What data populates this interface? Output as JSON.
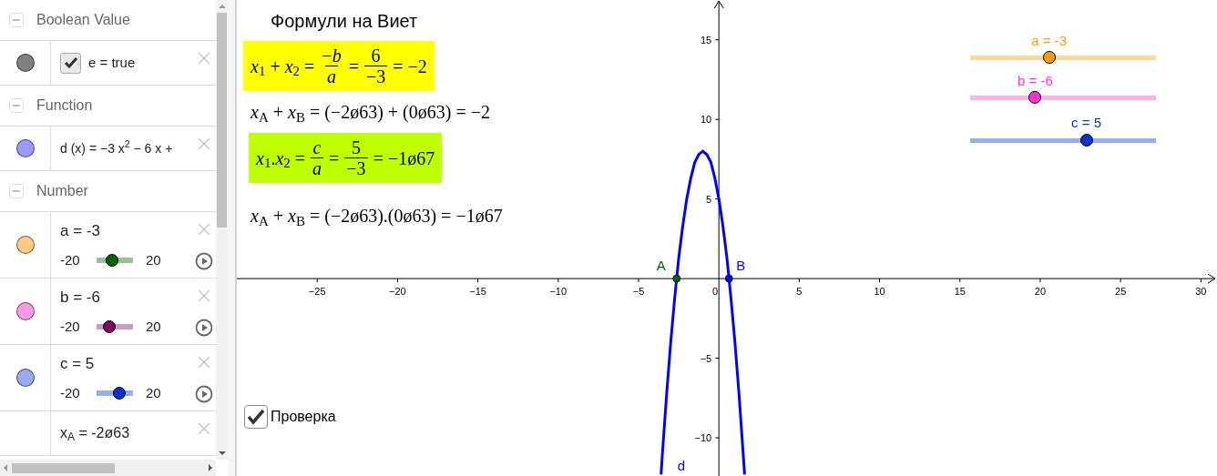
{
  "algebra": {
    "groups": [
      {
        "title": "Boolean Value",
        "expanded": true,
        "rows": [
          {
            "kind": "boolean",
            "color": "#808080",
            "checked": true,
            "text": "e = true"
          }
        ]
      },
      {
        "title": "Function",
        "expanded": true,
        "rows": [
          {
            "kind": "function",
            "color": "#9999ff",
            "text": "d (x) = −3 x$^{2}$ − 6 x +"
          }
        ]
      },
      {
        "title": "Number",
        "expanded": true,
        "rows": [
          {
            "kind": "slider",
            "color": "#ffcc88",
            "text": "a = -3",
            "slider": {
              "min": "-20",
              "max": "20",
              "level": 0.425,
              "color": "#006400"
            }
          },
          {
            "kind": "slider",
            "color": "#ff99e6",
            "text": "b = -6",
            "slider": {
              "min": "-20",
              "max": "20",
              "level": 0.35,
              "color": "#800060"
            }
          },
          {
            "kind": "slider",
            "color": "#99aaee",
            "text": "c = 5",
            "slider": {
              "min": "-20",
              "max": "20",
              "level": 0.625,
              "color": "#0033cc"
            }
          },
          {
            "kind": "value",
            "text": "x$_{A}$ = -2ø63"
          }
        ]
      }
    ]
  },
  "graphics": {
    "title": "Формули на Виет",
    "formulas": [
      {
        "color": "#ffff00",
        "parts": [
          {
            "kind": "text",
            "text": "*x*$_{1}$ + *x*$_{2}$ ="
          },
          {
            "kind": "frac",
            "num": "−*b*",
            "den": "*a*"
          },
          {
            "kind": "text",
            "text": "="
          },
          {
            "kind": "frac",
            "num": "6",
            "den": "−3"
          },
          {
            "kind": "text",
            "text": "= −2"
          }
        ]
      },
      {
        "parts": [
          {
            "kind": "text",
            "text": "*x*$_{A}$ + *x*$_{B}$ = (−2ø63) + (0ø63) = −2"
          }
        ]
      },
      {
        "color": "#bfff00",
        "parts": [
          {
            "kind": "text",
            "text": "*x*$_{1}$.*x*$_{2}$ ="
          },
          {
            "kind": "frac",
            "num": "*c*",
            "den": "*a*"
          },
          {
            "kind": "text",
            "text": "="
          },
          {
            "kind": "frac",
            "num": "5",
            "den": "−3"
          },
          {
            "kind": "text",
            "text": "= −1ø67"
          }
        ]
      },
      {
        "parts": [
          {
            "kind": "text",
            "text": "*x*$_{A}$ + *x*$_{B}$ = (−2ø63).(0ø63) = −1ø67"
          }
        ]
      }
    ],
    "checkbox": {
      "label": "Проверка",
      "checked": true
    },
    "sliders": [
      {
        "label": "a = -3",
        "level": 0.425,
        "color": "#ff9900"
      },
      {
        "label": "b = -6",
        "level": 0.35,
        "color": "#ff33cc"
      },
      {
        "label": "c = 5",
        "level": 0.625,
        "color": "#0033cc"
      }
    ],
    "chart_data": {
      "type": "line",
      "xlim": [
        -30,
        31
      ],
      "ylim": [
        -12.4,
        17.5
      ],
      "xticks": [
        {
          "value": -25,
          "label": "−25"
        },
        {
          "value": -20,
          "label": "−20"
        },
        {
          "value": -15,
          "label": "−15"
        },
        {
          "value": -10,
          "label": "−10"
        },
        {
          "value": -5,
          "label": "−5"
        },
        {
          "value": 0,
          "label": "0"
        },
        5,
        10,
        15,
        20,
        25,
        30
      ],
      "yticks": [
        {
          "value": -10,
          "label": "−10"
        },
        {
          "value": -5,
          "label": "−5"
        },
        5,
        10,
        15
      ],
      "x": [
        -3.6,
        -3.5,
        -3.25,
        -3,
        -2.75,
        -2.5,
        -2.25,
        -2,
        -1.75,
        -1.5,
        -1.25,
        -1,
        -0.75,
        -0.5,
        -0.25,
        0,
        0.25,
        0.5,
        0.75,
        1,
        1.25,
        1.5,
        1.6
      ],
      "series": [
        {
          "name": "d",
          "color": "#0000ff",
          "values": [
            -12.3,
            -10.8,
            -7.2,
            -4,
            -1.2,
            1.3,
            3.3,
            5,
            6.3,
            7.3,
            7.8,
            8,
            7.8,
            7.3,
            6.3,
            5,
            3.3,
            1.3,
            -1.2,
            -4,
            -7.2,
            -10.8,
            -12.3
          ]
        }
      ],
      "annotations": [
        {
          "text": "A",
          "x": -2.63,
          "y": 0
        },
        {
          "text": "B",
          "x": 0.63,
          "y": 0
        }
      ]
    },
    "points": [
      {
        "color": "#006400"
      },
      {
        "color": "#0000ff"
      }
    ]
  }
}
